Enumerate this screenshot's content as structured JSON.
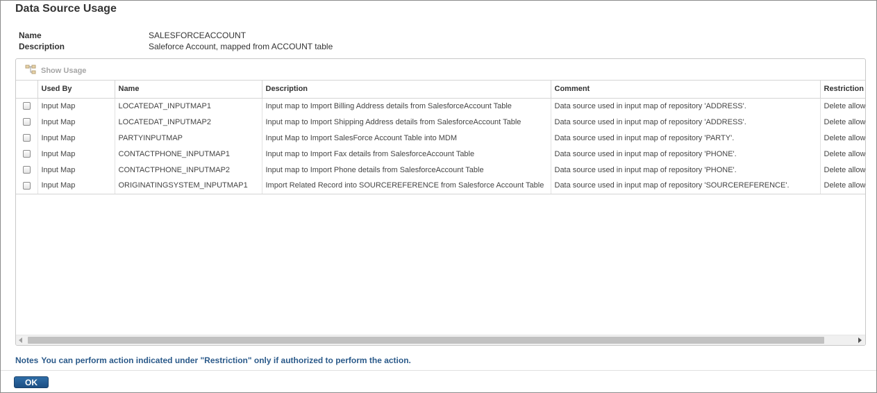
{
  "dialog": {
    "title": "Data Source Usage"
  },
  "info": {
    "name_label": "Name",
    "name_value": "SALESFORCEACCOUNT",
    "description_label": "Description",
    "description_value": "Saleforce Account, mapped from ACCOUNT table"
  },
  "toolbar": {
    "show_usage_label": "Show Usage",
    "show_usage_icon": "hierarchy-icon"
  },
  "table": {
    "columns": [
      "",
      "Used By",
      "Name",
      "Description",
      "Comment",
      "Restriction"
    ],
    "rows": [
      {
        "checked": false,
        "used_by": "Input Map",
        "name": "LOCATEDAT_INPUTMAP1",
        "description": "Input map to Import Billing Address details from SalesforceAccount Table",
        "comment": "Data source used in input map of repository 'ADDRESS'.",
        "restriction": "Delete allowed"
      },
      {
        "checked": false,
        "used_by": "Input Map",
        "name": "LOCATEDAT_INPUTMAP2",
        "description": "Input map to Import Shipping Address details from SalesforceAccount Table",
        "comment": "Data source used in input map of repository 'ADDRESS'.",
        "restriction": "Delete allowed"
      },
      {
        "checked": false,
        "used_by": "Input Map",
        "name": "PARTYINPUTMAP",
        "description": "Input Map to Import SalesForce Account Table into MDM",
        "comment": "Data source used in input map of repository 'PARTY'.",
        "restriction": "Delete allowed"
      },
      {
        "checked": false,
        "used_by": "Input Map",
        "name": "CONTACTPHONE_INPUTMAP1",
        "description": "Input map to Import Fax details from SalesforceAccount Table",
        "comment": "Data source used in input map of repository 'PHONE'.",
        "restriction": "Delete allowed"
      },
      {
        "checked": false,
        "used_by": "Input Map",
        "name": "CONTACTPHONE_INPUTMAP2",
        "description": "Input map to Import Phone details from SalesforceAccount Table",
        "comment": "Data source used in input map of repository 'PHONE'.",
        "restriction": "Delete allowed"
      },
      {
        "checked": false,
        "used_by": "Input Map",
        "name": "ORIGINATINGSYSTEM_INPUTMAP1",
        "description": "Import Related Record into SOURCEREFERENCE from Salesforce Account Table",
        "comment": "Data source used in input map of repository 'SOURCEREFERENCE'.",
        "restriction": "Delete allowed"
      }
    ]
  },
  "notes": {
    "label": "Notes",
    "text": "You can perform action indicated under \"Restriction\" only if authorized to perform the action."
  },
  "footer": {
    "ok_label": "OK"
  },
  "colors": {
    "notes_text": "#2b5a8a",
    "ok_button": "#1c4f83"
  }
}
